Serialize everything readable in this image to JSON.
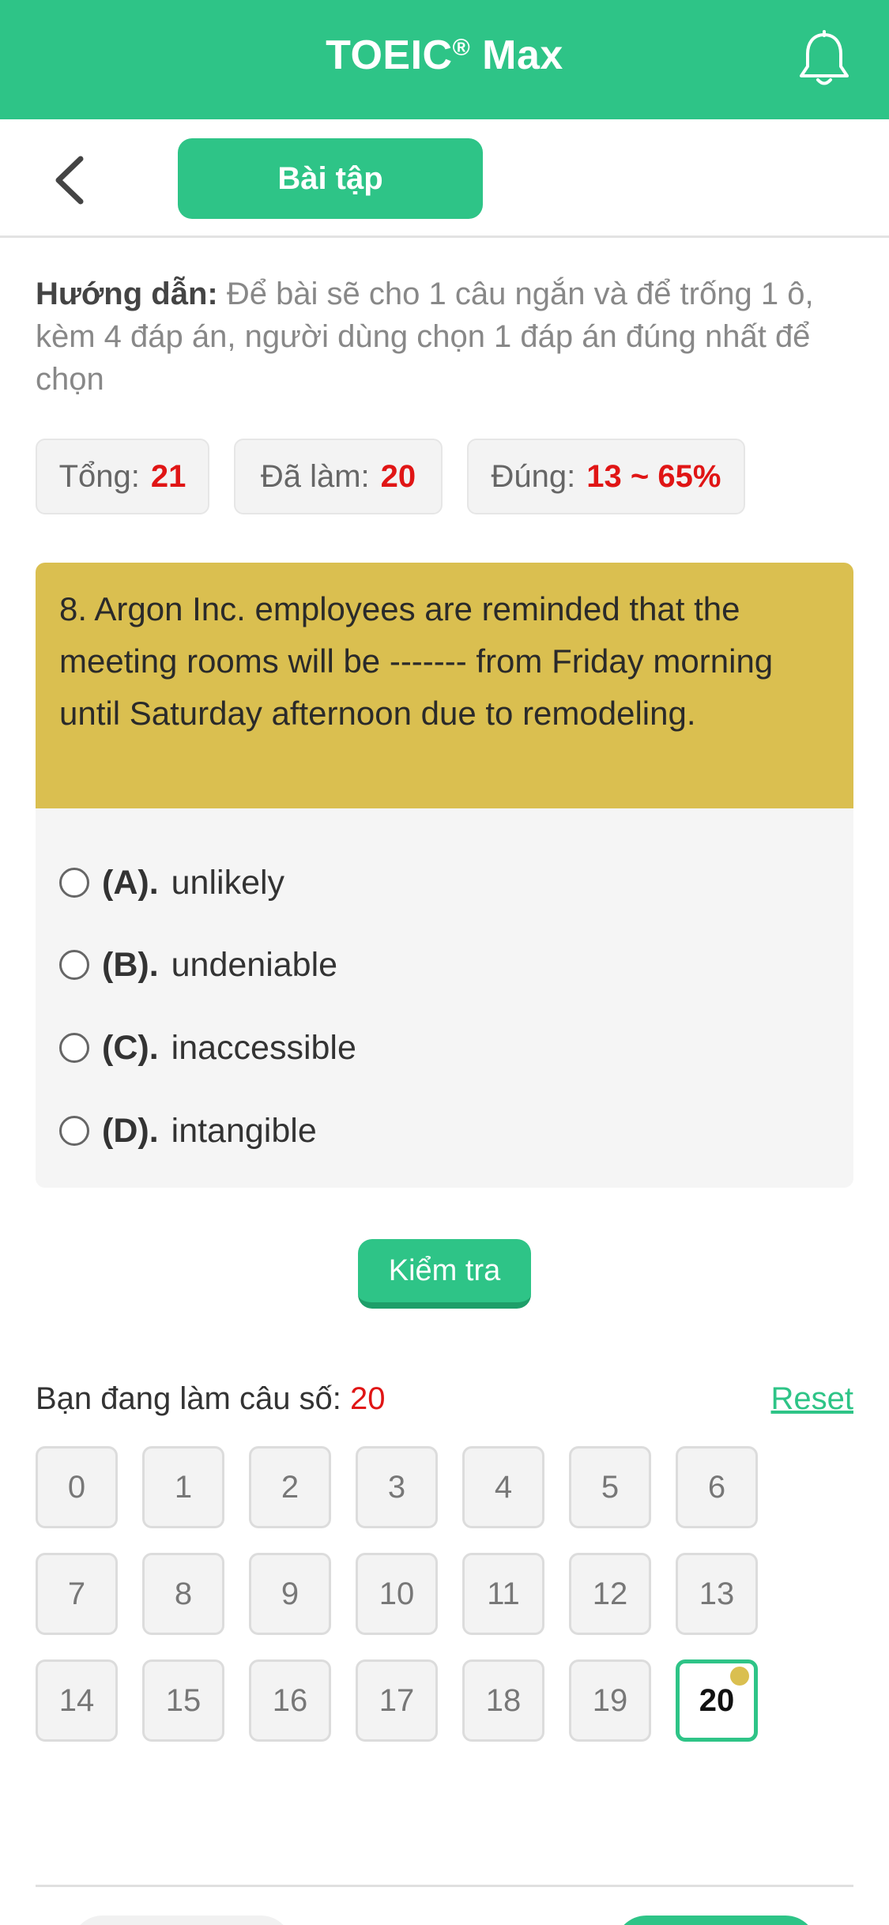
{
  "header": {
    "title": "TOEIC",
    "title_mark": "®",
    "title_suffix": " Max",
    "notification_icon": "bell-icon"
  },
  "subbar": {
    "back_icon": "chevron-left-icon",
    "tab_label": "Bài tập"
  },
  "instructions": {
    "label": "Hướng dẫn:",
    "text": " Để bài sẽ cho 1 câu ngắn và để trống 1 ô, kèm 4 đáp án, người dùng chọn 1 đáp án đúng nhất để chọn"
  },
  "stats": {
    "total_label": "Tổng:",
    "total_value": "21",
    "done_label": "Đã làm:",
    "done_value": "20",
    "correct_label": "Đúng:",
    "correct_value": "13 ~ 65%"
  },
  "question": {
    "text": "8. Argon Inc. employees are reminded that the meeting rooms will be ------- from Friday morning until Saturday afternoon due to remodeling.",
    "options": [
      {
        "label": "(A).",
        "text": "unlikely"
      },
      {
        "label": "(B).",
        "text": "undeniable"
      },
      {
        "label": "(C).",
        "text": "inaccessible"
      },
      {
        "label": "(D).",
        "text": "intangible"
      }
    ]
  },
  "check_button": "Kiểm tra",
  "progress": {
    "label": "Bạn đang làm câu số: ",
    "current": "20",
    "reset": "Reset"
  },
  "grid": [
    "0",
    "1",
    "2",
    "3",
    "4",
    "5",
    "6",
    "7",
    "8",
    "9",
    "10",
    "11",
    "12",
    "13",
    "14",
    "15",
    "16",
    "17",
    "18",
    "19",
    "20"
  ],
  "colors": {
    "brand": "#2ec487",
    "question_bg": "#dabf50",
    "highlight": "#e01515"
  }
}
